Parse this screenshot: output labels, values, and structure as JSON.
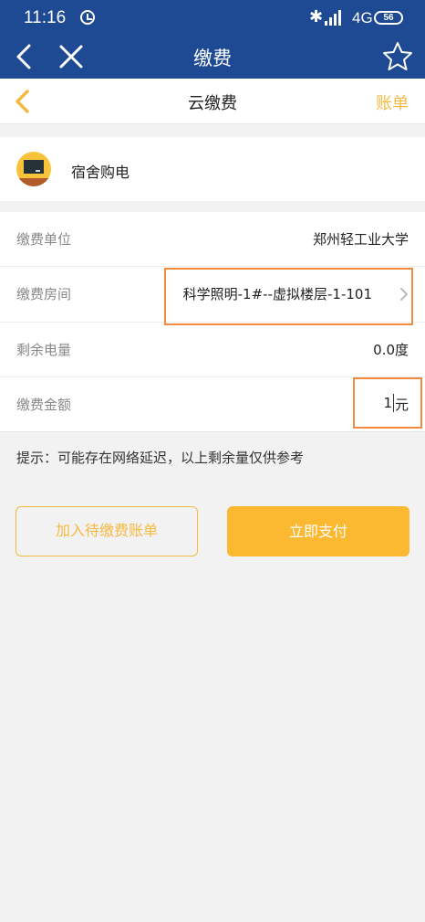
{
  "status_bar": {
    "time": "11:16",
    "network": "4G",
    "battery": "56",
    "icons": [
      "alarm-icon",
      "bluetooth-icon",
      "signal-icon",
      "battery-icon"
    ]
  },
  "nav": {
    "title": "缴费",
    "icons": [
      "back-arrow-icon",
      "close-icon",
      "star-icon"
    ]
  },
  "sub_header": {
    "title": "云缴费",
    "bill_link": "账单"
  },
  "service": {
    "label": "宿舍购电",
    "icon": "classroom-icon"
  },
  "form": {
    "unit_label": "缴费单位",
    "unit_value": "郑州轻工业大学",
    "room_label": "缴费房间",
    "room_value": "科学照明-1#--虚拟楼层-1-101",
    "remaining_label": "剩余电量",
    "remaining_value": "0.0度",
    "amount_label": "缴费金额",
    "amount_value": "1",
    "amount_unit": "元"
  },
  "tip": "提示：可能存在网络延迟，以上剩余量仅供参考",
  "buttons": {
    "add_to_bill": "加入待缴费账单",
    "pay_now": "立即支付"
  },
  "colors": {
    "nav_bg": "#1e4a94",
    "accent": "#f5b941",
    "highlight": "#f08a3c"
  }
}
